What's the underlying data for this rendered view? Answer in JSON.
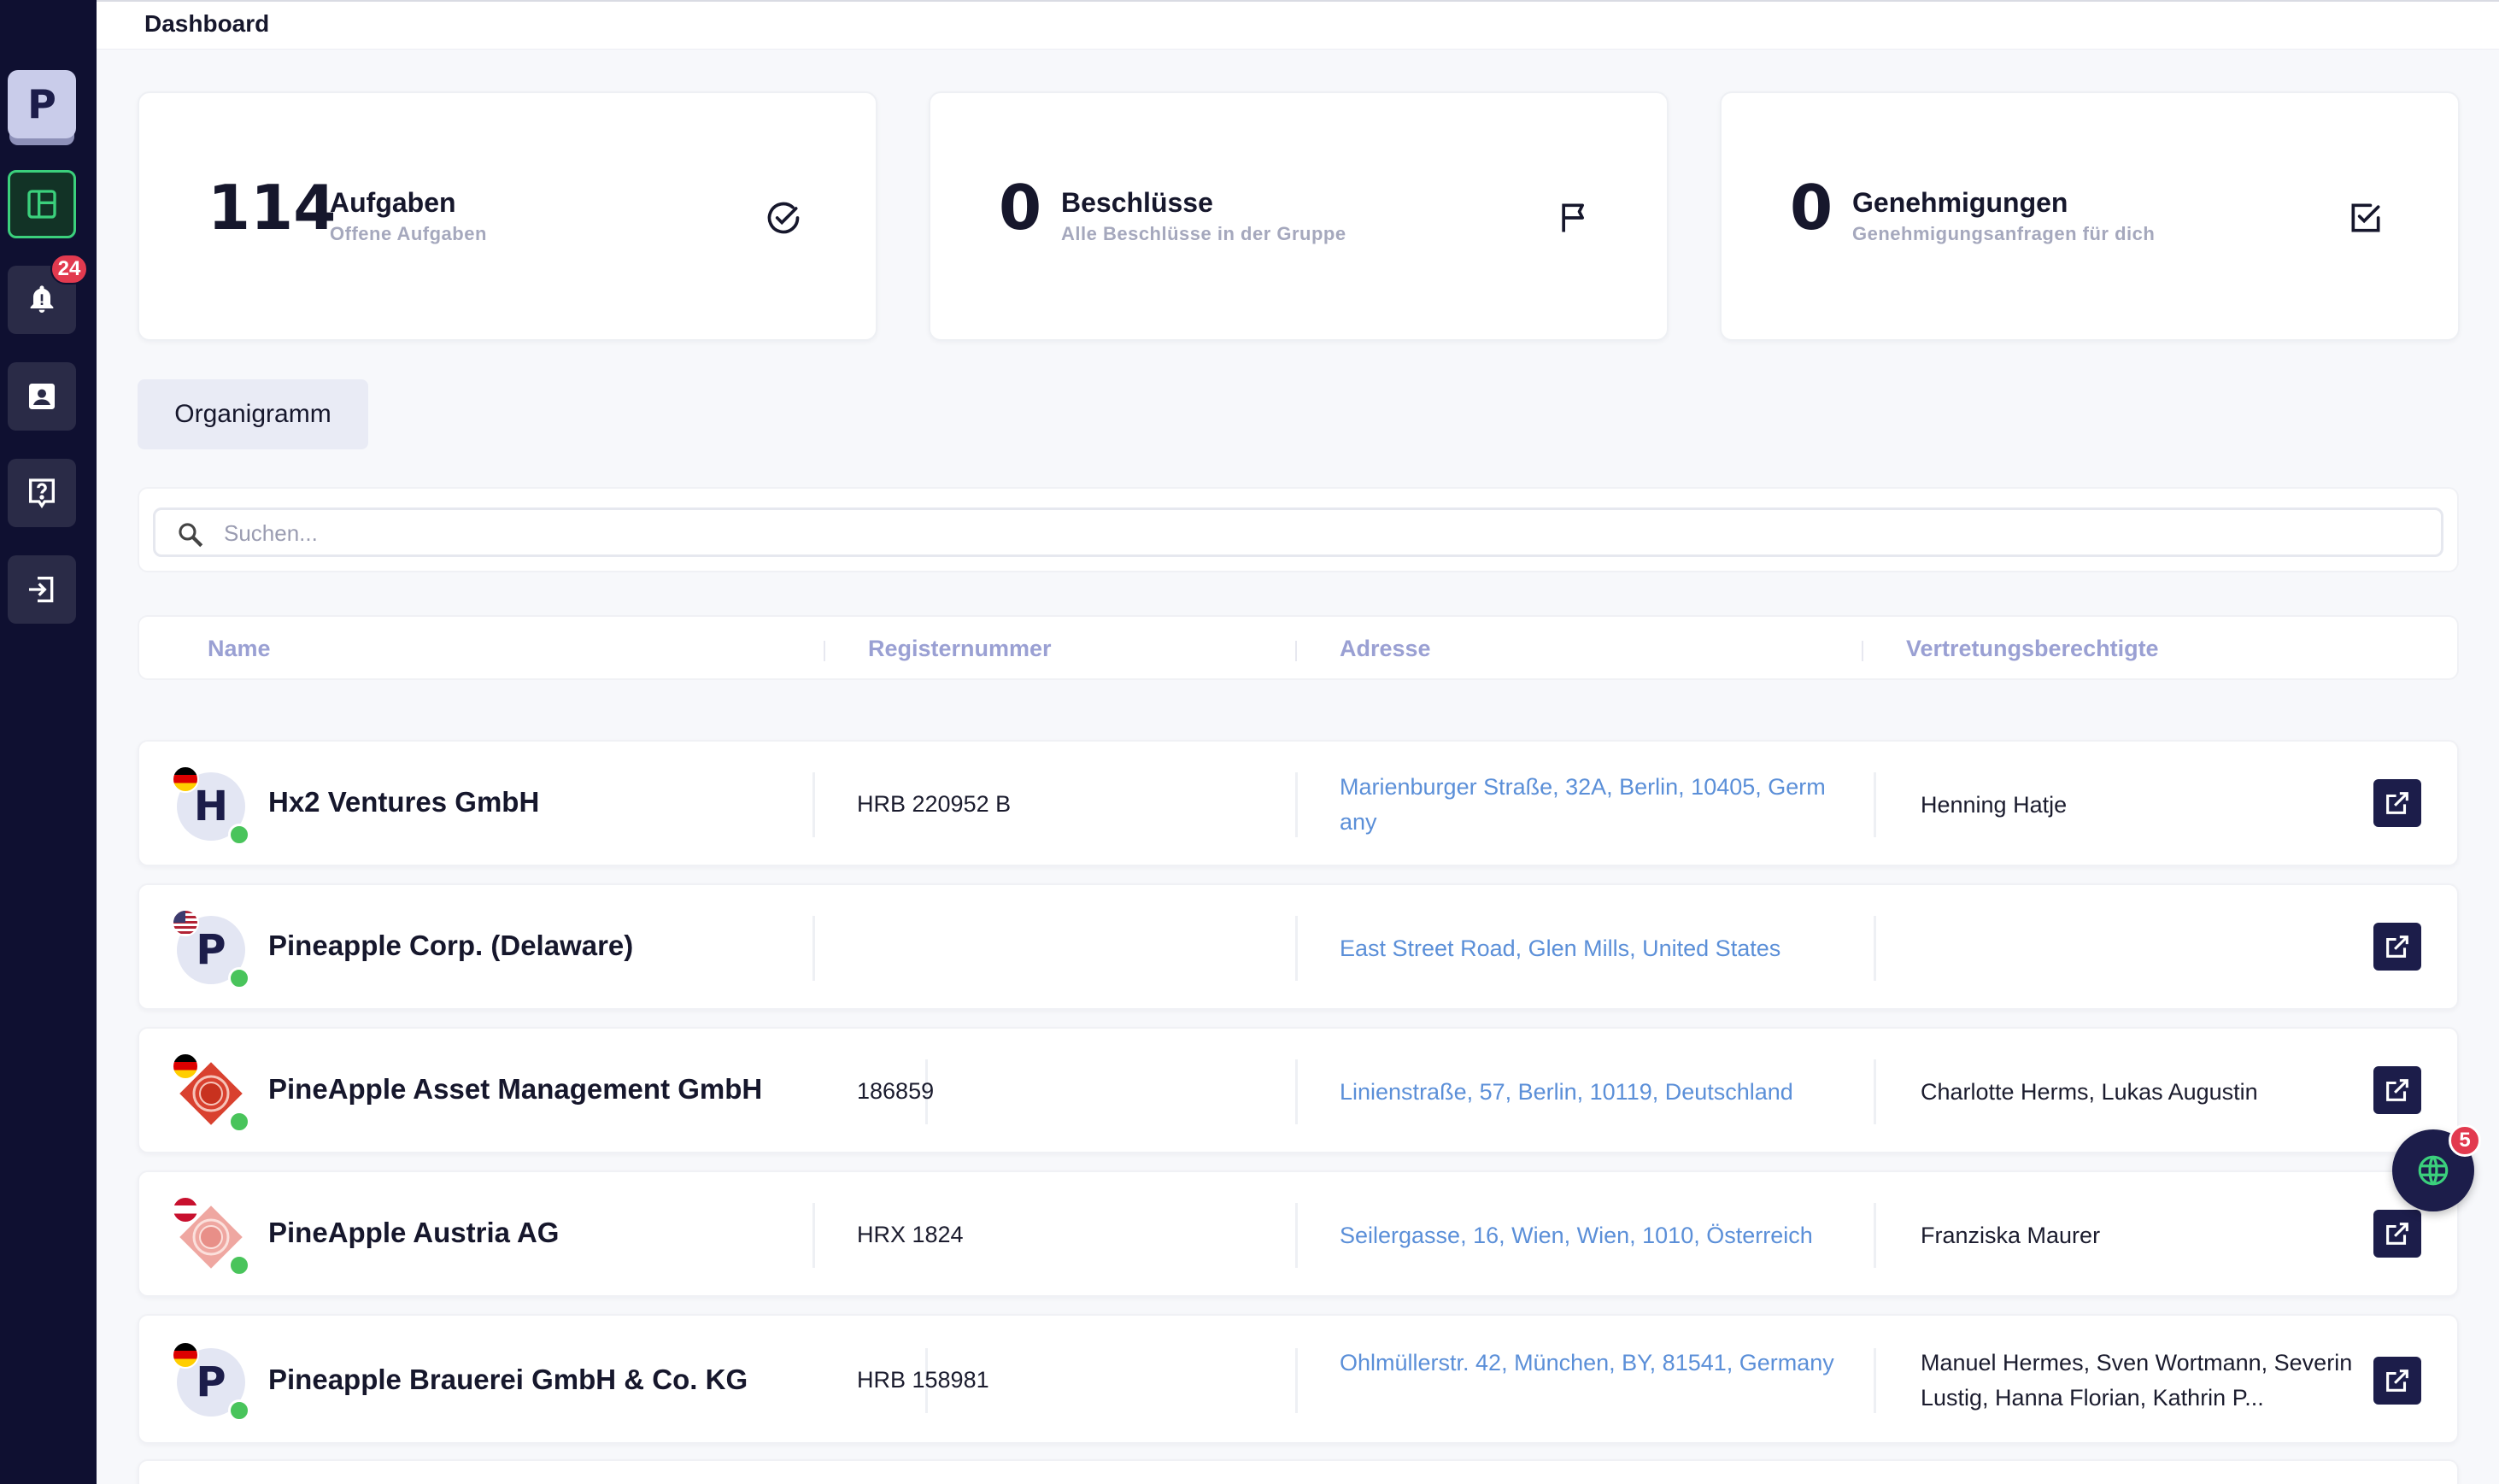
{
  "sidebar": {
    "logo_letter": "P",
    "items": [
      {
        "name": "dashboard",
        "icon": "layout-icon",
        "active": true
      },
      {
        "name": "notifications",
        "icon": "bell-icon",
        "badge": "24"
      },
      {
        "name": "contacts",
        "icon": "contact-card-icon"
      },
      {
        "name": "help",
        "icon": "help-icon"
      },
      {
        "name": "logout",
        "icon": "logout-icon"
      }
    ]
  },
  "header": {
    "title": "Dashboard"
  },
  "stats": [
    {
      "value": "114",
      "title": "Aufgaben",
      "subtitle": "Offene Aufgaben",
      "icon": "check-circle-icon"
    },
    {
      "value": "0",
      "title": "Beschlüsse",
      "subtitle": "Alle Beschlüsse in der Gruppe",
      "icon": "flag-icon"
    },
    {
      "value": "0",
      "title": "Genehmigungen",
      "subtitle": "Genehmigungsanfragen für dich",
      "icon": "checkbox-icon"
    }
  ],
  "organigramm_label": "Organigramm",
  "search": {
    "placeholder": "Suchen..."
  },
  "table": {
    "columns": [
      "Name",
      "Registernummer",
      "Adresse",
      "Vertretungsberechtigte"
    ],
    "rows": [
      {
        "avatar": "H",
        "flag": "de",
        "name": "Hx2 Ventures GmbH",
        "register": "HRB 220952 B",
        "address": "Marienburger Straße, 32A, Berlin, 10405, Germany",
        "representatives": "Henning Hatje"
      },
      {
        "avatar": "P",
        "flag": "us",
        "name": "Pineapple Corp. (Delaware)",
        "register": "",
        "address": "East Street Road, Glen Mills, United States",
        "representatives": ""
      },
      {
        "avatar": "logo-red",
        "flag": "de",
        "name": "PineApple Asset Management GmbH",
        "register": "186859",
        "address": "Linienstraße, 57, Berlin, 10119, Deutschland",
        "representatives": "Charlotte Herms, Lukas Augustin"
      },
      {
        "avatar": "logo-pink",
        "flag": "at",
        "name": "PineApple Austria AG",
        "register": "HRX 1824",
        "address": "Seilergasse, 16, Wien, Wien, 1010, Österreich",
        "representatives": "Franziska Maurer"
      },
      {
        "avatar": "P",
        "flag": "de",
        "name": "Pineapple Brauerei GmbH & Co. KG",
        "register": "HRB 158981",
        "address": "Ohlmüllerstr. 42, München, BY, 81541, Germany",
        "representatives": "Manuel Hermes, Sven Wortmann, Severin Lustig, Hanna Florian, Kathrin P..."
      }
    ]
  },
  "fab": {
    "icon": "globe-icon",
    "badge": "5"
  },
  "colors": {
    "sidebar": "#0f1031",
    "accent": "#1c1d4a",
    "link": "#5b8fd8",
    "header_text": "#9aa0d3",
    "badge": "#e23a4f",
    "online": "#49c45b"
  }
}
